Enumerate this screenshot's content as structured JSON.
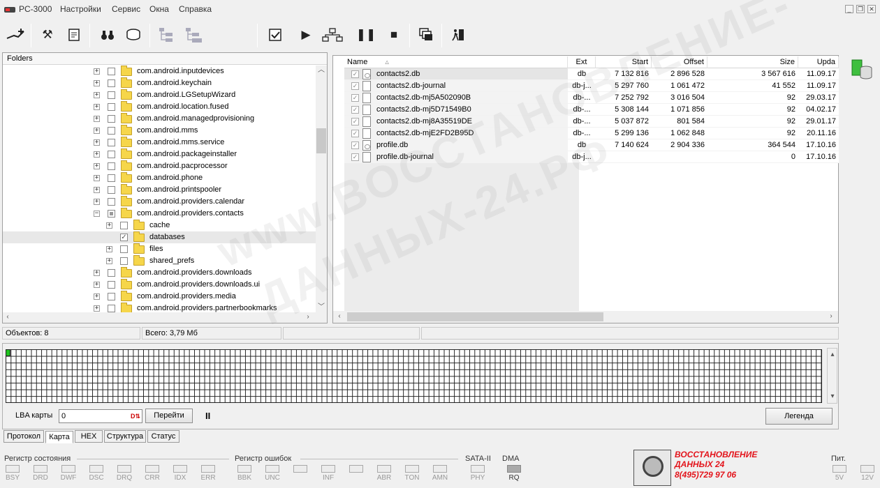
{
  "app": {
    "title": "PC-3000"
  },
  "menu": [
    "Настройки",
    "Сервис",
    "Окна",
    "Справка"
  ],
  "window_controls": {
    "minimize": "_",
    "restore": "❐",
    "close": "✕"
  },
  "toolbar": {
    "icons": [
      "connect-icon",
      "tools-icon",
      "scroll-icon",
      "binoculars-icon",
      "disk-icon",
      "tree-icon",
      "tree-alt-icon",
      "check-icon",
      "play-icon",
      "graph-icon",
      "pause-icon",
      "stop-icon",
      "windows-icon",
      "exit-icon"
    ]
  },
  "folders": {
    "header": "Folders",
    "items": [
      {
        "label": "com.android.inputdevices",
        "level": 0,
        "expander": "+",
        "checked": ""
      },
      {
        "label": "com.android.keychain",
        "level": 0,
        "expander": "+",
        "checked": ""
      },
      {
        "label": "com.android.LGSetupWizard",
        "level": 0,
        "expander": "+",
        "checked": ""
      },
      {
        "label": "com.android.location.fused",
        "level": 0,
        "expander": "+",
        "checked": ""
      },
      {
        "label": "com.android.managedprovisioning",
        "level": 0,
        "expander": "+",
        "checked": ""
      },
      {
        "label": "com.android.mms",
        "level": 0,
        "expander": "+",
        "checked": ""
      },
      {
        "label": "com.android.mms.service",
        "level": 0,
        "expander": "+",
        "checked": ""
      },
      {
        "label": "com.android.packageinstaller",
        "level": 0,
        "expander": "+",
        "checked": ""
      },
      {
        "label": "com.android.pacprocessor",
        "level": 0,
        "expander": "+",
        "checked": ""
      },
      {
        "label": "com.android.phone",
        "level": 0,
        "expander": "+",
        "checked": ""
      },
      {
        "label": "com.android.printspooler",
        "level": 0,
        "expander": "+",
        "checked": ""
      },
      {
        "label": "com.android.providers.calendar",
        "level": 0,
        "expander": "+",
        "checked": ""
      },
      {
        "label": "com.android.providers.contacts",
        "level": 0,
        "expander": "−",
        "checked": "partial"
      },
      {
        "label": "cache",
        "level": 1,
        "expander": "+",
        "checked": ""
      },
      {
        "label": "databases",
        "level": 1,
        "expander": "",
        "checked": "✓",
        "selected": true
      },
      {
        "label": "files",
        "level": 1,
        "expander": "+",
        "checked": ""
      },
      {
        "label": "shared_prefs",
        "level": 1,
        "expander": "+",
        "checked": ""
      },
      {
        "label": "com.android.providers.downloads",
        "level": 0,
        "expander": "+",
        "checked": ""
      },
      {
        "label": "com.android.providers.downloads.ui",
        "level": 0,
        "expander": "+",
        "checked": ""
      },
      {
        "label": "com.android.providers.media",
        "level": 0,
        "expander": "+",
        "checked": ""
      },
      {
        "label": "com.android.providers.partnerbookmarks",
        "level": 0,
        "expander": "+",
        "checked": ""
      }
    ]
  },
  "files": {
    "columns": [
      "Name",
      "Ext",
      "Start",
      "Offset",
      "Size",
      "Upda"
    ],
    "rows": [
      {
        "name": "contacts2.db",
        "ext": "db",
        "start": "7 132 816",
        "offset": "2 896 528",
        "size": "3 567 616",
        "upda": "11.09.17",
        "icon": "db"
      },
      {
        "name": "contacts2.db-journal",
        "ext": "db-j...",
        "start": "5 297 760",
        "offset": "1 061 472",
        "size": "41 552",
        "upda": "11.09.17",
        "icon": "file"
      },
      {
        "name": "contacts2.db-mj5A502090B",
        "ext": "db-...",
        "start": "7 252 792",
        "offset": "3 016 504",
        "size": "92",
        "upda": "29.03.17",
        "icon": "file"
      },
      {
        "name": "contacts2.db-mj5D71549B0",
        "ext": "db-...",
        "start": "5 308 144",
        "offset": "1 071 856",
        "size": "92",
        "upda": "04.02.17",
        "icon": "file"
      },
      {
        "name": "contacts2.db-mj8A35519DE",
        "ext": "db-...",
        "start": "5 037 872",
        "offset": "801 584",
        "size": "92",
        "upda": "29.01.17",
        "icon": "file"
      },
      {
        "name": "contacts2.db-mjE2FD2B95D",
        "ext": "db-...",
        "start": "5 299 136",
        "offset": "1 062 848",
        "size": "92",
        "upda": "20.11.16",
        "icon": "file"
      },
      {
        "name": "profile.db",
        "ext": "db",
        "start": "7 140 624",
        "offset": "2 904 336",
        "size": "364 544",
        "upda": "17.10.16",
        "icon": "db"
      },
      {
        "name": "profile.db-journal",
        "ext": "db-j...",
        "start": "",
        "offset": "",
        "size": "0",
        "upda": "17.10.16",
        "icon": "file"
      }
    ]
  },
  "status": {
    "objects": "Объектов: 8",
    "total": "Всего: 3,79 Мб"
  },
  "map": {
    "lba_label": "LBA карты",
    "lba_value": "0",
    "goto_label": "Перейти",
    "legend_label": "Легенда",
    "pause": "II"
  },
  "tabs": [
    "Протокол",
    "Карта",
    "HEX",
    "Структура",
    "Статус"
  ],
  "registers": {
    "status_title": "Регистр состояния",
    "status": [
      "BSY",
      "DRD",
      "DWF",
      "DSC",
      "DRQ",
      "CRR",
      "IDX",
      "ERR"
    ],
    "error_title": "Регистр ошибок",
    "error": [
      "BBK",
      "UNC",
      "",
      "INF",
      "",
      "ABR",
      "TON",
      "AMN"
    ],
    "sata_title": "SATA-II",
    "sata": [
      "PHY"
    ],
    "dma_title": "DMA",
    "dma": [
      "RQ"
    ],
    "power_title": "Пит.",
    "power": [
      "5V",
      "12V"
    ]
  },
  "ad": {
    "line1": "ВОССТАНОВЛЕНИЕ",
    "line2": "ДАННЫХ  24",
    "line3": "8(495)729 97 06"
  },
  "watermark": {
    "line1": "www.ВОССТАНОВЛЕНИЕ-",
    "line2": "ДАННЫХ-24.РФ"
  }
}
